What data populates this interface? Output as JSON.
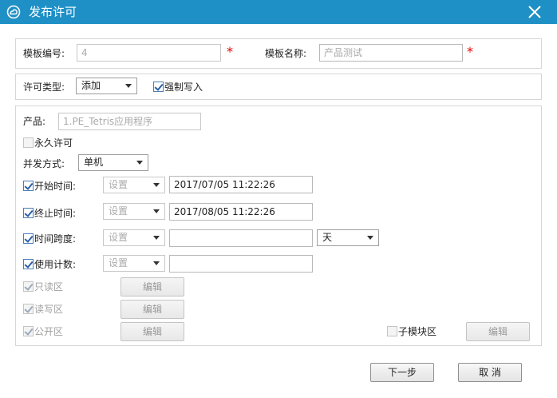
{
  "window": {
    "title": "发布许可",
    "close_icon": "close-icon",
    "logo_icon": "cloud-logo-icon",
    "title_color": "#1e90c6"
  },
  "template": {
    "id_label": "模板编号:",
    "id_value": "4",
    "name_label": "模板名称:",
    "name_placeholder": "产品测试",
    "required_mark": "*"
  },
  "license": {
    "type_label": "许可类型:",
    "type_value": "添加",
    "force_write_label": "强制写入",
    "force_write_checked": true
  },
  "product": {
    "label": "产品:",
    "value": "1.PE_Tetris应用程序",
    "permanent_label": "永久许可",
    "permanent_checked": false,
    "concurrency_label": "并发方式:",
    "concurrency_value": "单机"
  },
  "rows": [
    {
      "label": "开始时间:",
      "checked": true,
      "mode": "设置",
      "value": "2017/07/05 11:22:26"
    },
    {
      "label": "终止时间:",
      "checked": true,
      "mode": "设置",
      "value": "2017/08/05 11:22:26"
    },
    {
      "label": "时间跨度:",
      "checked": true,
      "mode": "设置",
      "value": "",
      "unit": "天"
    },
    {
      "label": "使用计数:",
      "checked": true,
      "mode": "设置",
      "value": ""
    }
  ],
  "areas": [
    {
      "label": "只读区",
      "checked": true,
      "button": "编辑"
    },
    {
      "label": "读写区",
      "checked": true,
      "button": "编辑"
    },
    {
      "label": "公开区",
      "checked": true,
      "button": "编辑"
    }
  ],
  "submodule": {
    "label": "子模块区",
    "checked": false,
    "button": "编辑"
  },
  "footer": {
    "next_label": "下一步",
    "cancel_label": "取 消"
  }
}
